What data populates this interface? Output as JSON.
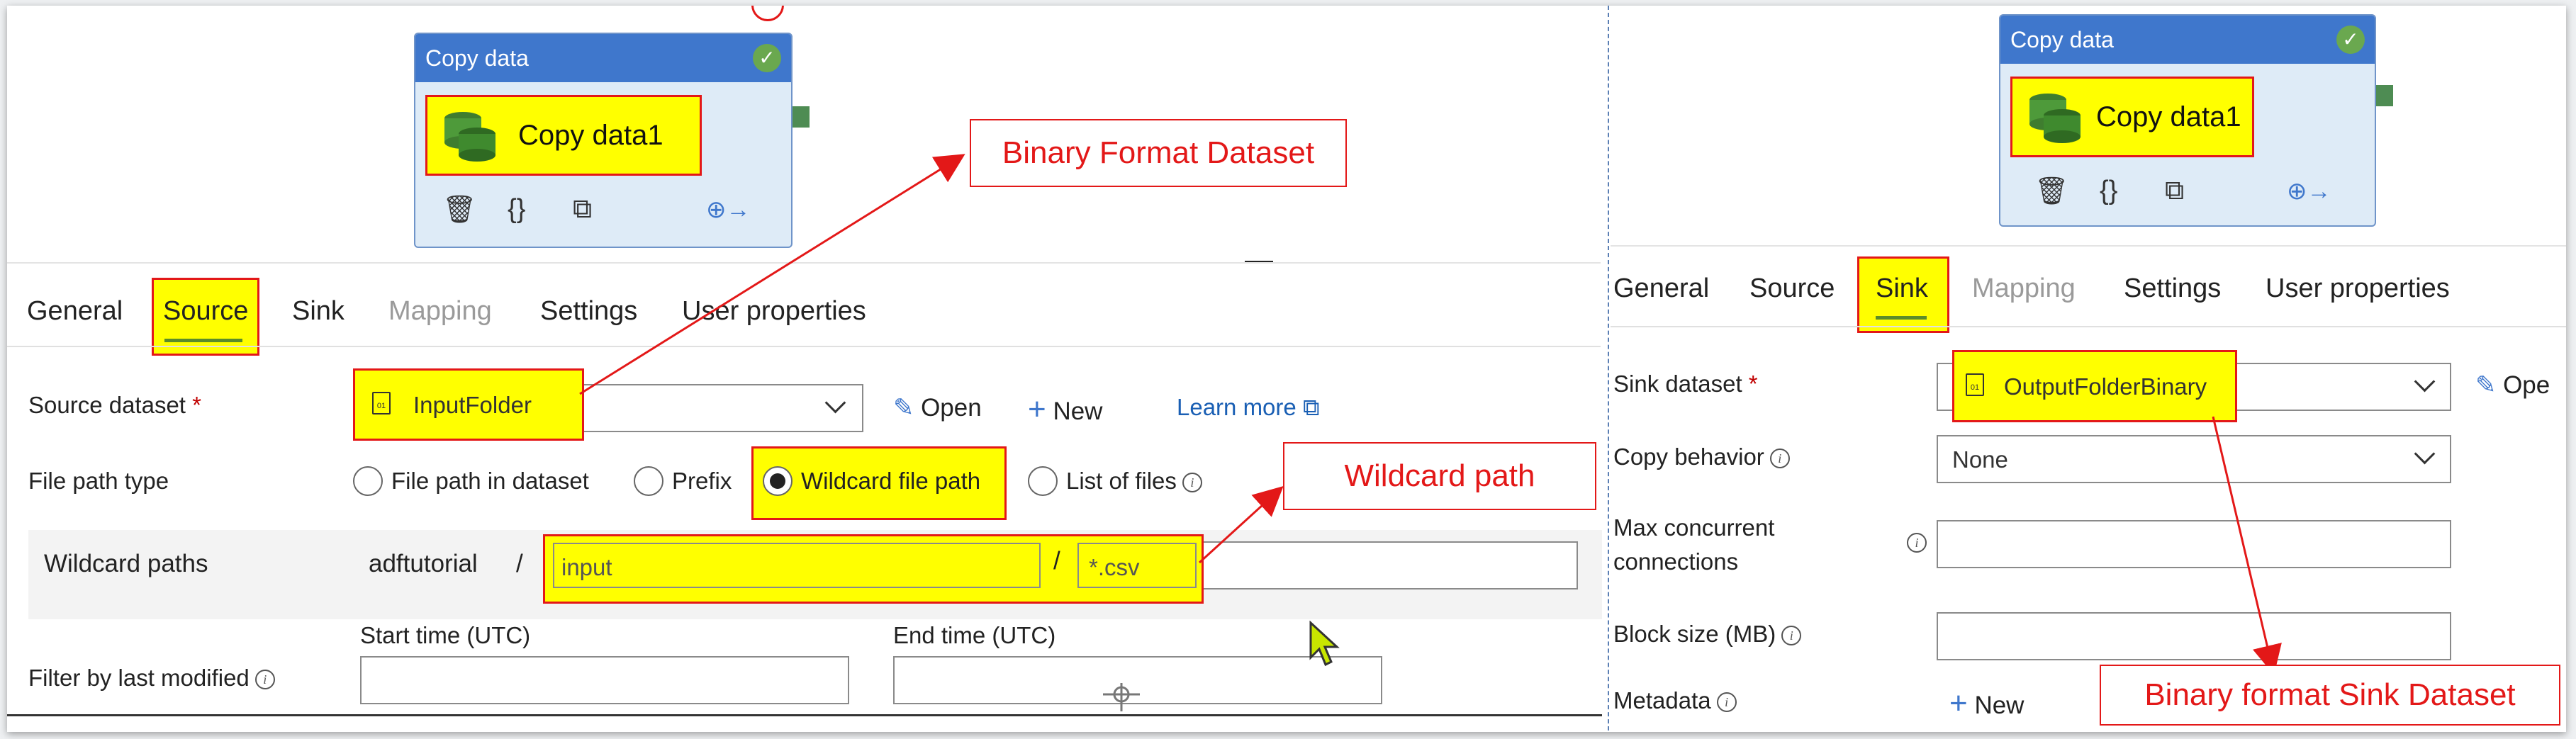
{
  "left_panel": {
    "node": {
      "header": "Copy data",
      "name": "Copy data1"
    },
    "tabs": [
      {
        "label": "General"
      },
      {
        "label": "Source"
      },
      {
        "label": "Sink"
      },
      {
        "label": "Mapping"
      },
      {
        "label": "Settings"
      },
      {
        "label": "User properties"
      }
    ],
    "source_dataset": {
      "label": "Source dataset",
      "required": "*",
      "value": "InputFolder",
      "open": "Open",
      "new": "New",
      "learn_more": "Learn more"
    },
    "file_path_type": {
      "label": "File path type",
      "options": [
        {
          "label": "File path in dataset"
        },
        {
          "label": "Prefix"
        },
        {
          "label": "Wildcard file path"
        },
        {
          "label": "List of files"
        }
      ]
    },
    "wildcard_paths": {
      "label": "Wildcard paths",
      "container": "adftutorial",
      "separator": "/",
      "folder": "input",
      "file": "*.csv"
    },
    "filter": {
      "label": "Filter by last modified",
      "start_label": "Start time (UTC)",
      "end_label": "End time (UTC)"
    }
  },
  "right_panel": {
    "node": {
      "header": "Copy data",
      "name": "Copy data1"
    },
    "tabs": [
      {
        "label": "General"
      },
      {
        "label": "Source"
      },
      {
        "label": "Sink"
      },
      {
        "label": "Mapping"
      },
      {
        "label": "Settings"
      },
      {
        "label": "User properties"
      }
    ],
    "sink_dataset": {
      "label": "Sink dataset",
      "required": "*",
      "value": "OutputFolderBinary",
      "open": "Ope"
    },
    "copy_behavior": {
      "label": "Copy behavior",
      "value": "None"
    },
    "max_connections": {
      "label_line1": "Max concurrent",
      "label_line2": "connections"
    },
    "block_size": {
      "label": "Block size (MB)"
    },
    "metadata": {
      "label": "Metadata",
      "new": "New"
    }
  },
  "callouts": {
    "binary_format_dataset": "Binary Format Dataset",
    "wildcard_path": "Wildcard path",
    "binary_sink_dataset": "Binary format Sink Dataset"
  },
  "colors": {
    "highlight": "#ffff00",
    "annotation": "#e31818",
    "node_header": "#3f77cc",
    "active_tab_underline": "#5b8c2a",
    "link": "#1a5fb4"
  },
  "icons": [
    "check-icon",
    "database-icon",
    "trash-icon",
    "code-braces-icon",
    "copy-icon",
    "add-output-icon",
    "pencil-icon",
    "plus-icon",
    "external-link-icon",
    "info-icon",
    "file-icon",
    "chevron-down-icon"
  ]
}
